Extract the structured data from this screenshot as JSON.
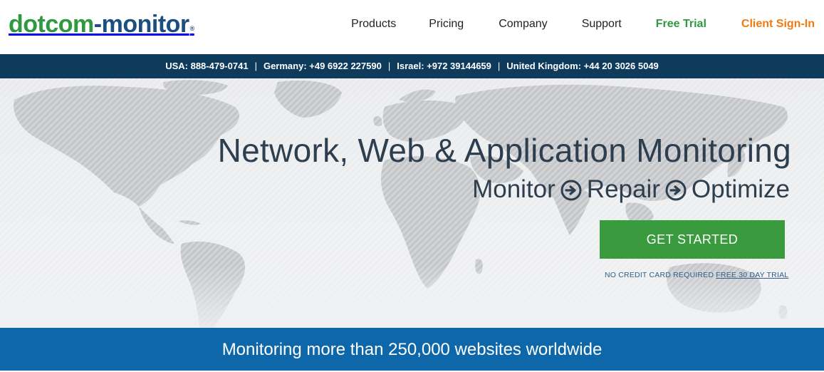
{
  "logo": {
    "part1": "dotcom",
    "dash": "-",
    "part2": "monitor",
    "mark": "®"
  },
  "nav": {
    "products": "Products",
    "pricing": "Pricing",
    "company": "Company",
    "support": "Support",
    "free_trial": "Free Trial",
    "client_signin": "Client Sign-In"
  },
  "phones": [
    "USA: 888-479-0741",
    "Germany: +49 6922 227590",
    "Israel: +972 39144659",
    "United Kingdom: +44 20 3026 5049"
  ],
  "phone_separator": "|",
  "hero": {
    "title": "Network, Web & Application Monitoring",
    "sub": [
      "Monitor",
      "Repair",
      "Optimize"
    ],
    "cta": "GET STARTED",
    "note_prefix": "NO CREDIT CARD REQUIRED",
    "note_link": "FREE 30 DAY TRIAL"
  },
  "band": {
    "text": "Monitoring more than 250,000 websites worldwide"
  },
  "colors": {
    "brand_green": "#2d9a3f",
    "brand_blue": "#1b4f82",
    "signin_orange": "#f07a12",
    "phonebar_bg": "#0e3a5c",
    "cta_green": "#3a9a3e",
    "band_blue": "#0e67a8"
  },
  "icons": [
    "arrow-right-circle-icon"
  ]
}
